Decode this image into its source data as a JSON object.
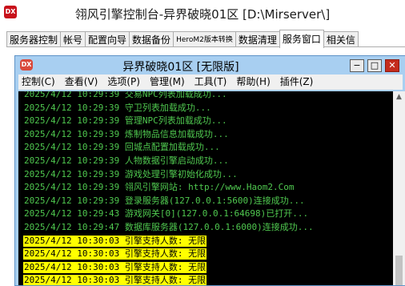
{
  "outer_window": {
    "logo_text": "DX",
    "title": "翎风引擎控制台-异界破晓01区 [D:\\Mirserver\\]"
  },
  "tabs": [
    {
      "label": "服务器控制",
      "active": false,
      "small": false
    },
    {
      "label": "帐号",
      "active": false,
      "small": false
    },
    {
      "label": "配置向导",
      "active": false,
      "small": false
    },
    {
      "label": "数据备份",
      "active": false,
      "small": false
    },
    {
      "label": "HeroM2版本转换",
      "active": false,
      "small": true
    },
    {
      "label": "数据清理",
      "active": false,
      "small": false
    },
    {
      "label": "服务窗口",
      "active": true,
      "small": false
    },
    {
      "label": "相关信",
      "active": false,
      "small": false
    }
  ],
  "inner_window": {
    "logo_text": "DX",
    "title": "异界破晓01区 [无限版]",
    "buttons": {
      "minimize": "−",
      "maximize": "□",
      "close": "✕"
    }
  },
  "menu": [
    "控制(C)",
    "查看(V)",
    "选项(P)",
    "管理(M)",
    "工具(T)",
    "帮助(H)",
    "插件(Z)"
  ],
  "log_lines": [
    {
      "text": "2025/4/12 10:29:39 交易NPC列表加载成功...",
      "highlight": false
    },
    {
      "text": "2025/4/12 10:29:39 守卫列表加载成功...",
      "highlight": false
    },
    {
      "text": "2025/4/12 10:29:39 管理NPC列表加载成功...",
      "highlight": false
    },
    {
      "text": "2025/4/12 10:29:39 炼制物品信息加载成功...",
      "highlight": false
    },
    {
      "text": "2025/4/12 10:29:39 回城点配置加载成功...",
      "highlight": false
    },
    {
      "text": "2025/4/12 10:29:39 人物数据引擎启动成功...",
      "highlight": false
    },
    {
      "text": "2025/4/12 10:29:39 游戏处理引擎初始化成功...",
      "highlight": false
    },
    {
      "text": "2025/4/12 10:29:39 翎风引擎网站: http://www.Haom2.Com",
      "highlight": false
    },
    {
      "text": "2025/4/12 10:29:39 登录服务器(127.0.0.1:5600)连接成功...",
      "highlight": false
    },
    {
      "text": "2025/4/12 10:29:43 游戏网关[0](127.0.0.1:64698)已打开...",
      "highlight": false
    },
    {
      "text": "2025/4/12 10:29:47 数据库服务器(127.0.0.1:6000)连接成功...",
      "highlight": false
    },
    {
      "text": "2025/4/12 10:30:03 引擎支持人数: 无限",
      "highlight": true
    },
    {
      "text": "2025/4/12 10:30:03 引擎支持人数: 无限",
      "highlight": true
    },
    {
      "text": "2025/4/12 10:30:03 引擎支持人数: 无限",
      "highlight": true
    },
    {
      "text": "2025/4/12 10:30:03 引擎支持人数: 无限",
      "highlight": true
    }
  ],
  "colors": {
    "log_text": "#4fc84f",
    "highlight_bg": "#ffff00",
    "highlight_text": "#000000",
    "console_bg": "#000000",
    "inner_frame": "#a8cff1"
  }
}
